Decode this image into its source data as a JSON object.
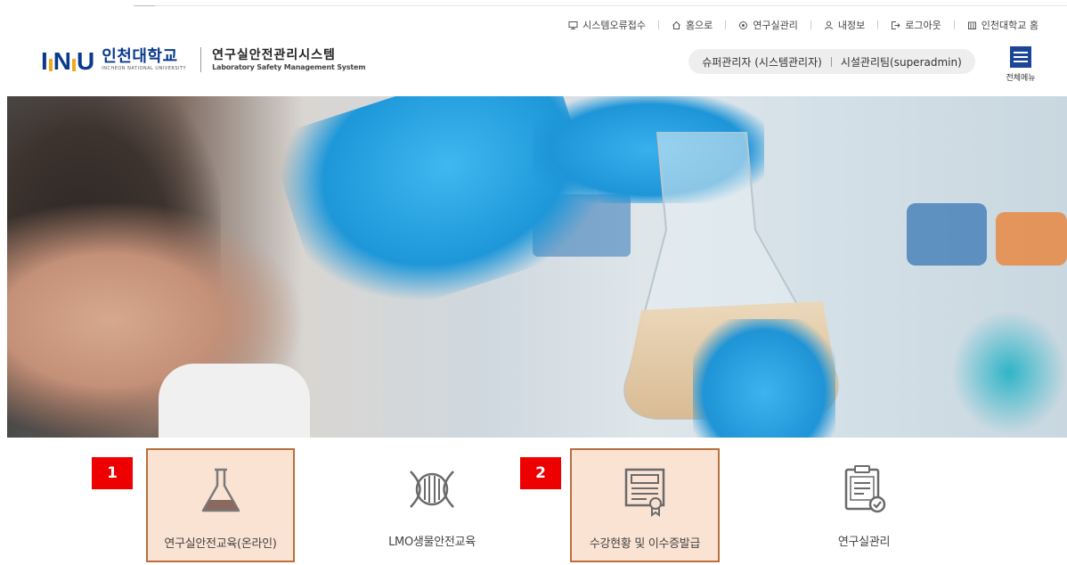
{
  "util_nav": [
    {
      "label": "시스템오류접수",
      "icon": "monitor-icon"
    },
    {
      "label": "홈으로",
      "icon": "home-icon"
    },
    {
      "label": "연구실관리",
      "icon": "lab-icon"
    },
    {
      "label": "내정보",
      "icon": "user-icon"
    },
    {
      "label": "로그아웃",
      "icon": "logout-icon"
    },
    {
      "label": "인천대학교 홈",
      "icon": "building-icon"
    }
  ],
  "logo": {
    "mark": "INU",
    "kr": "인천대학교",
    "en": "INCHEON NATIONAL UNIVERSITY"
  },
  "system": {
    "kr": "연구실안전관리시스템",
    "en": "Laboratory Safety Management System"
  },
  "user": {
    "role": "슈퍼관리자 (시스템관리자)",
    "dept": "시설관리팀(superadmin)"
  },
  "all_menu": {
    "label": "전체메뉴",
    "icon": "hamburger-icon"
  },
  "banner": {
    "slides": 2,
    "active_slide": 1
  },
  "quick_menu": [
    {
      "label": "연구실안전교육(온라인)",
      "icon": "flask-icon",
      "highlighted": true
    },
    {
      "label": "LMO생물안전교육",
      "icon": "dna-icon",
      "highlighted": false
    },
    {
      "label": "수강현황 및 이수증발급",
      "icon": "certificate-icon",
      "highlighted": true
    },
    {
      "label": "연구실관리",
      "icon": "clipboard-check-icon",
      "highlighted": false
    }
  ],
  "annotations": [
    "1",
    "2"
  ],
  "colors": {
    "brand": "#0b3a8d",
    "accent": "#f3a81c",
    "highlight_bg": "#fbe3d4",
    "highlight_border": "#b7703f",
    "badge": "#ee0000"
  }
}
